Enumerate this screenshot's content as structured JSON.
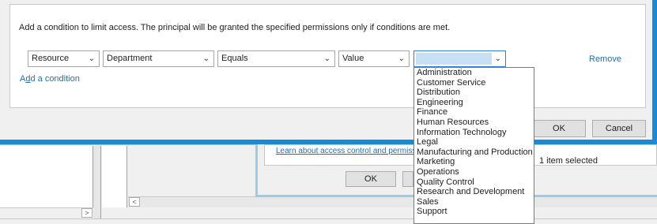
{
  "condition_dialog": {
    "instruction": "Add a condition to limit access. The principal will be granted the specified permissions only if conditions are met.",
    "condition_row": {
      "attribute_type": "Resource",
      "attribute": "Department",
      "operator": "Equals",
      "value_type": "Value",
      "value": "",
      "remove_label": "Remove"
    },
    "add_condition_prefix": "A",
    "add_condition_accel": "d",
    "add_condition_suffix": "d a condition",
    "ok_label": "OK",
    "cancel_label": "Cancel"
  },
  "value_dropdown": {
    "options": [
      "Administration",
      "Customer Service",
      "Distribution",
      "Engineering",
      "Finance",
      "Human Resources",
      "Information Technology",
      "Legal",
      "Manufacturing and Production",
      "Marketing",
      "Operations",
      "Quality Control",
      "Research and Development",
      "Sales",
      "Support"
    ]
  },
  "background_dialog": {
    "learn_link": "Learn about access control and permissio",
    "ok_label": "OK",
    "status": "1 item selected"
  },
  "glyphs": {
    "chevron": "⌄",
    "arrow_right": ">",
    "arrow_left": "<"
  },
  "colors": {
    "accent_blue": "#1a8bd3",
    "link_blue": "#1d6fb5"
  }
}
